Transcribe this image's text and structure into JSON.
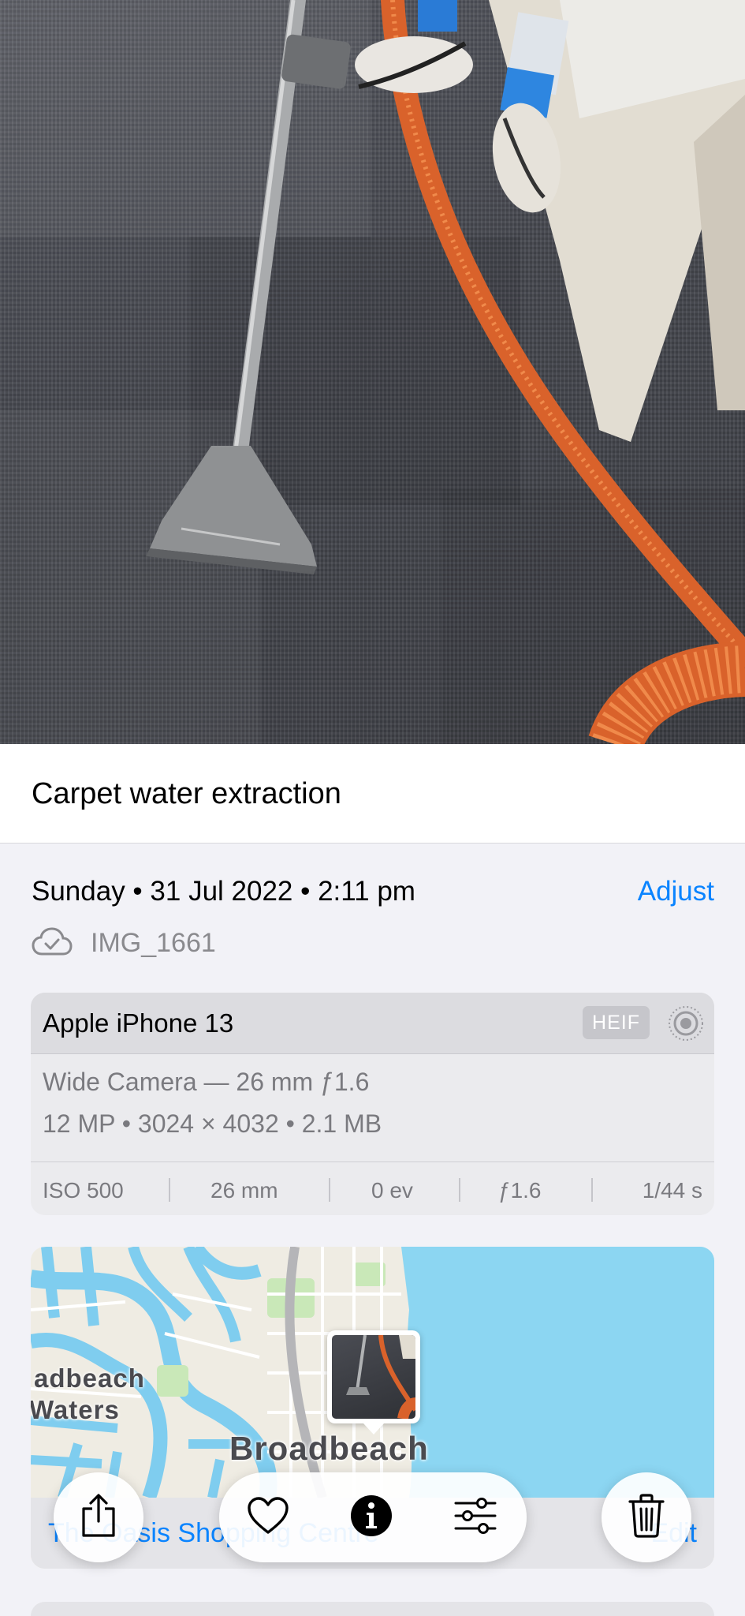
{
  "caption": "Carpet water extraction",
  "date_line": "Sunday • 31 Jul 2022 • 2:11 pm",
  "adjust_label": "Adjust",
  "file_name": "IMG_1661",
  "camera": {
    "model": "Apple iPhone 13",
    "format": "HEIF",
    "lens": "Wide Camera — 26 mm ƒ1.6",
    "specs": "12 MP • 3024 × 4032 • 2.1 MB",
    "exif": {
      "iso": "ISO 500",
      "focal": "26 mm",
      "ev": "0 ev",
      "aperture": "ƒ1.6",
      "shutter": "1/44 s"
    }
  },
  "map": {
    "label_waters_1": "adbeach",
    "label_waters_2": "Waters",
    "label_suburb": "Broadbeach",
    "location_name": "The Oasis Shopping Centre",
    "location_action": "Edit"
  },
  "toolbar": {
    "share_icon": "share-icon",
    "favorite_icon": "heart-icon",
    "info_icon": "info-icon",
    "adjust_icon": "sliders-icon",
    "delete_icon": "trash-icon"
  },
  "colors": {
    "accent": "#0a84ff",
    "hose": "#d9622b",
    "water": "#8cd6f2"
  }
}
